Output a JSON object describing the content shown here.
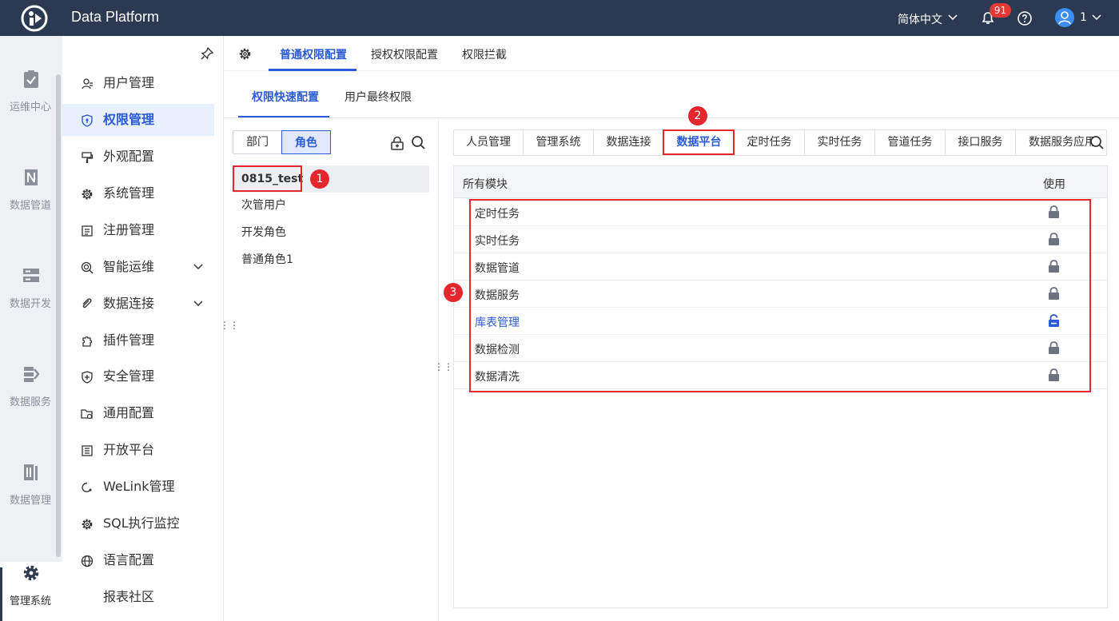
{
  "app": {
    "title": "Data Platform"
  },
  "header": {
    "language": "简体中文",
    "notification_count": "91",
    "user": "1"
  },
  "rail": [
    {
      "label": "运维中心",
      "icon": "clipboard-check-icon"
    },
    {
      "label": "数据管道",
      "icon": "pipeline-icon"
    },
    {
      "label": "数据开发",
      "icon": "server-icon"
    },
    {
      "label": "数据服务",
      "icon": "data-service-icon"
    },
    {
      "label": "数据管理",
      "icon": "data-management-icon"
    },
    {
      "label": "管理系统",
      "icon": "gear-icon",
      "active": true
    }
  ],
  "menu": [
    {
      "label": "用户管理",
      "icon": "user-icon"
    },
    {
      "label": "权限管理",
      "icon": "shield-icon",
      "active": true
    },
    {
      "label": "外观配置",
      "icon": "appearance-icon"
    },
    {
      "label": "系统管理",
      "icon": "gear-icon"
    },
    {
      "label": "注册管理",
      "icon": "register-icon"
    },
    {
      "label": "智能运维",
      "icon": "smart-ops-icon",
      "expandable": true
    },
    {
      "label": "数据连接",
      "icon": "link-icon",
      "expandable": true
    },
    {
      "label": "插件管理",
      "icon": "puzzle-icon"
    },
    {
      "label": "安全管理",
      "icon": "shield-plus-icon"
    },
    {
      "label": "通用配置",
      "icon": "folder-gear-icon"
    },
    {
      "label": "开放平台",
      "icon": "document-icon"
    },
    {
      "label": "WeLink管理",
      "icon": "welink-icon"
    },
    {
      "label": "SQL执行监控",
      "icon": "gear-icon"
    },
    {
      "label": "语言配置",
      "icon": "globe-icon"
    },
    {
      "label": "报表社区",
      "icon": ""
    }
  ],
  "tabs_level1": [
    {
      "label": "普通权限配置",
      "active": true
    },
    {
      "label": "授权权限配置"
    },
    {
      "label": "权限拦截"
    }
  ],
  "tabs_level2": [
    {
      "label": "权限快速配置",
      "active": true
    },
    {
      "label": "用户最终权限"
    }
  ],
  "role_panel": {
    "segment": {
      "dept": "部门",
      "role": "角色"
    },
    "roles": [
      "0815_test",
      "次管用户",
      "开发角色",
      "普通角色1"
    ],
    "selected_index": 0
  },
  "module_tabs": [
    "人员管理",
    "管理系统",
    "数据连接",
    "数据平台",
    "定时任务",
    "实时任务",
    "管道任务",
    "接口服务",
    "数据服务应用"
  ],
  "module_tabs_active": "数据平台",
  "table": {
    "header_module": "所有模块",
    "header_use": "使用",
    "rows": [
      {
        "name": "定时任务",
        "locked": true
      },
      {
        "name": "实时任务",
        "locked": true
      },
      {
        "name": "数据管道",
        "locked": true
      },
      {
        "name": "数据服务",
        "locked": true
      },
      {
        "name": "库表管理",
        "locked": false,
        "highlight": true
      },
      {
        "name": "数据检测",
        "locked": true
      },
      {
        "name": "数据清洗",
        "locked": true
      }
    ]
  },
  "annotations": [
    "1",
    "2",
    "3"
  ],
  "colors": {
    "accent": "#2a5ad6",
    "topbar": "#2b3a52",
    "annotation": "#e5262d"
  }
}
